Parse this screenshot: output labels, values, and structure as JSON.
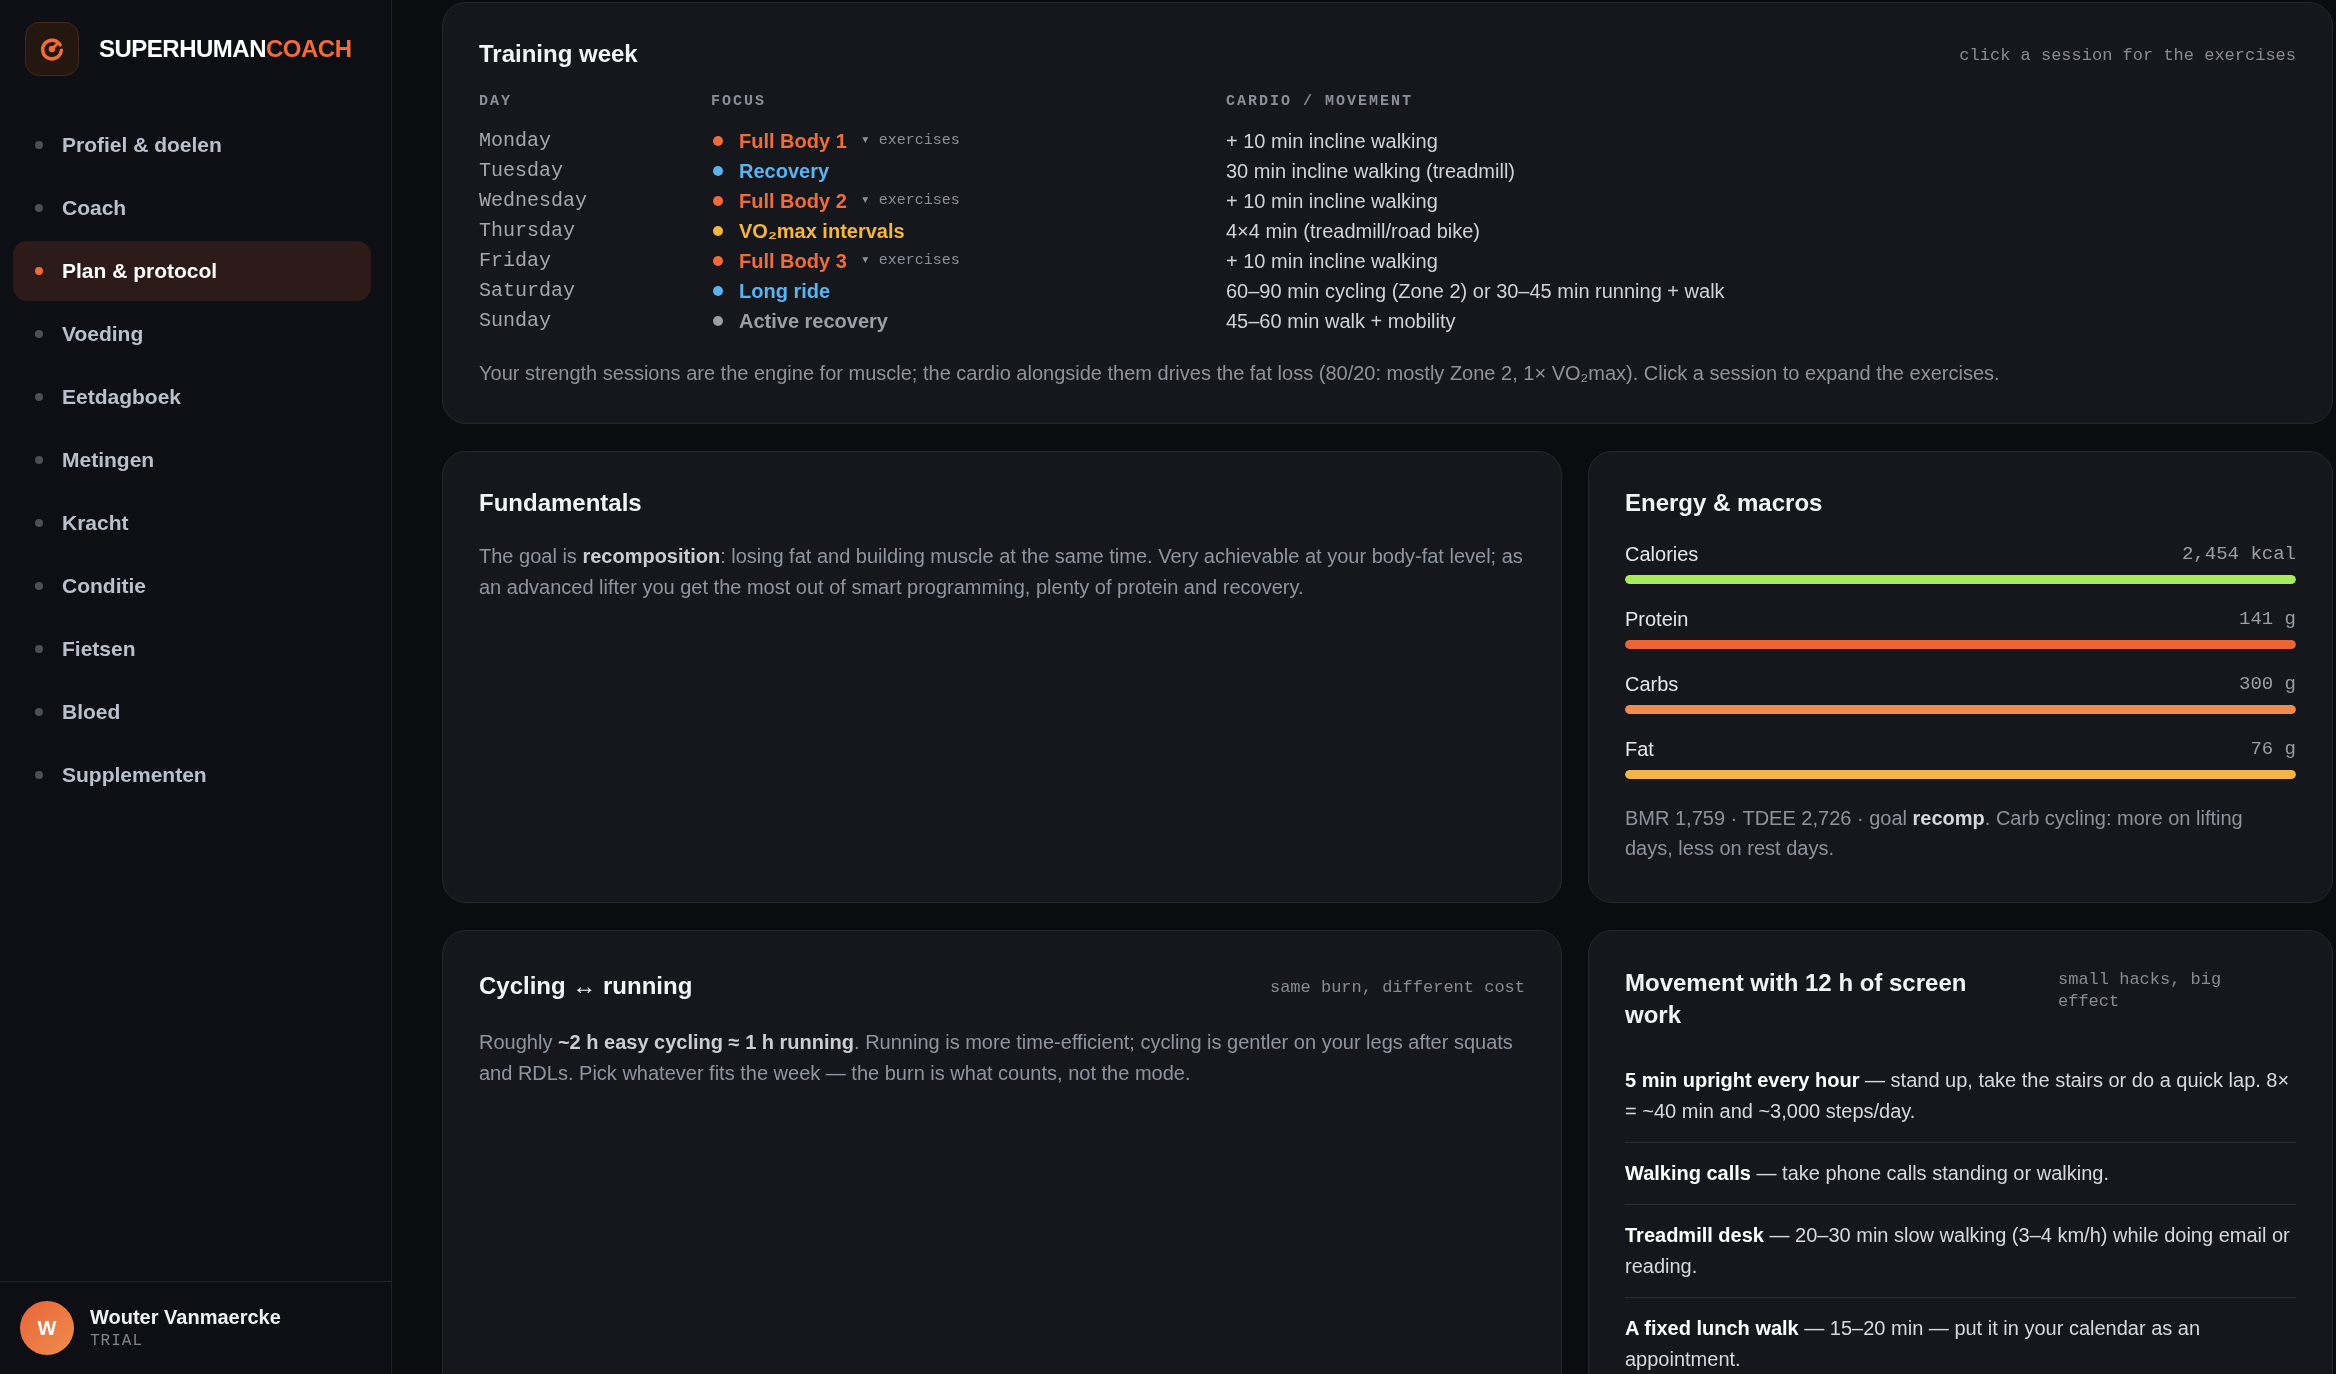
{
  "sidebar": {
    "brand": {
      "name": "SUPERHUMAN",
      "accent": "COACH"
    },
    "items": [
      {
        "label": "Profiel & doelen",
        "selected": false
      },
      {
        "label": "Coach",
        "selected": false
      },
      {
        "label": "Plan & protocol",
        "selected": true
      },
      {
        "label": "Voeding",
        "selected": false
      },
      {
        "label": "Eetdagboek",
        "selected": false
      },
      {
        "label": "Metingen",
        "selected": false
      },
      {
        "label": "Kracht",
        "selected": false
      },
      {
        "label": "Conditie",
        "selected": false
      },
      {
        "label": "Fietsen",
        "selected": false
      },
      {
        "label": "Bloed",
        "selected": false
      },
      {
        "label": "Supplementen",
        "selected": false
      }
    ],
    "user": {
      "initial": "W",
      "name": "Wouter Vanmaercke",
      "plan": "TRIAL"
    }
  },
  "training_week": {
    "title": "Training week",
    "hint": "click a session for the exercises",
    "columns": [
      "DAY",
      "FOCUS",
      "CARDIO / MOVEMENT"
    ],
    "rows": [
      {
        "day": "Monday",
        "focus": "Full Body 1",
        "color": "#f26b3a",
        "toggle": "▾ exercises",
        "cardio": "+ 10 min incline walking"
      },
      {
        "day": "Tuesday",
        "focus": "Recovery",
        "color": "#5bb4f0",
        "cardio": "30 min incline walking (treadmill)"
      },
      {
        "day": "Wednesday",
        "focus": "Full Body 2",
        "color": "#f26b3a",
        "toggle": "▾ exercises",
        "cardio": "+ 10 min incline walking"
      },
      {
        "day": "Thursday",
        "focus": "VO₂max intervals",
        "color": "#f5b73f",
        "cardio": "4×4 min (treadmill/road bike)"
      },
      {
        "day": "Friday",
        "focus": "Full Body 3",
        "color": "#f26b3a",
        "toggle": "▾ exercises",
        "cardio": "+ 10 min incline walking"
      },
      {
        "day": "Saturday",
        "focus": "Long ride",
        "color": "#5bb4f0",
        "cardio": "60–90 min cycling (Zone 2) or 30–45 min running + walk"
      },
      {
        "day": "Sunday",
        "focus": "Active recovery",
        "color": "#9b9ea6",
        "cardio": "45–60 min walk + mobility"
      }
    ],
    "note": "Your strength sessions are the engine for muscle; the cardio alongside them drives the fat loss (80/20: mostly Zone 2, 1× VO₂max). Click a session to expand the exercises."
  },
  "fundamentals": {
    "title": "Fundamentals",
    "text": "The goal is **recomposition**: losing fat and building muscle at the same time. Very achievable at your body-fat level; as an advanced lifter you get the most out of smart programming, plenty of protein and recovery."
  },
  "energy_macros": {
    "title": "Energy & macros",
    "rows": [
      {
        "label": "Calories",
        "value": "2,454 kcal",
        "level": 1,
        "color": "#a6ec5c"
      },
      {
        "label": "Protein",
        "value": "141 g",
        "level": 1,
        "color": "#ec6434"
      },
      {
        "label": "Carbs",
        "value": "300 g",
        "level": 1,
        "color": "#f08c4e"
      },
      {
        "label": "Fat",
        "value": "76 g",
        "level": 1,
        "color": "#f4b548"
      }
    ],
    "note": "BMR 1,759 · TDEE 2,726 · goal **recomp**. Carb cycling: more on lifting days, less on rest days."
  },
  "cycling_running": {
    "title": "Cycling ↔ running",
    "hint": "same burn, different cost",
    "text": "Roughly **~2 h easy cycling ≈ 1 h running**. Running is more time-efficient; cycling is gentler on your legs after squats and RDLs. Pick whatever fits the week — the burn is what counts, not the mode."
  },
  "movement": {
    "title": "Movement with 12 h of screen work",
    "hint": "small hacks, big effect",
    "items": [
      "**5 min upright every hour** — stand up, take the stairs or do a quick lap. 8× = ~40 min and ~3,000 steps/day.",
      "**Walking calls** — take phone calls standing or walking.",
      "**Treadmill desk** — 20–30 min slow walking (3–4 km/h) while doing email or reading.",
      "**A fixed lunch walk** — 15–20 min — put it in your calendar as an appointment."
    ]
  }
}
